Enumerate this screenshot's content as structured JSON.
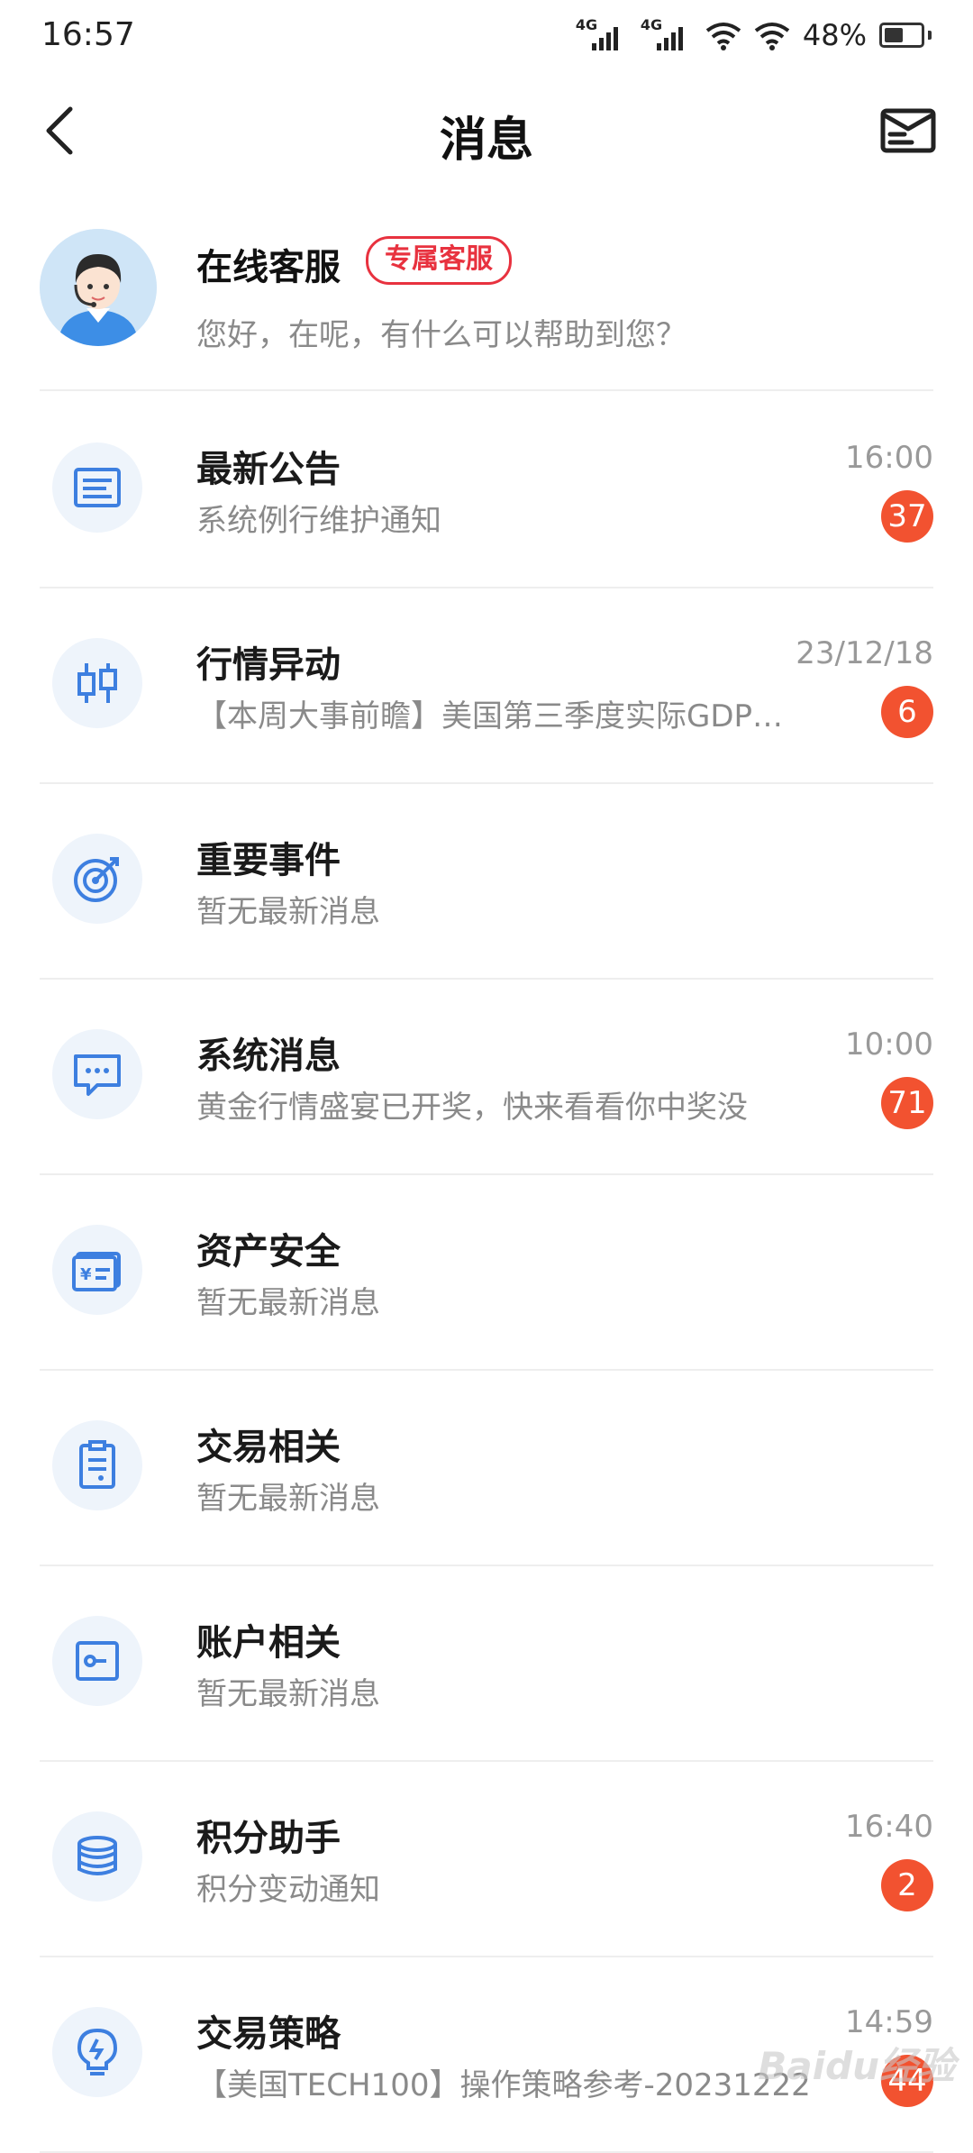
{
  "status_bar": {
    "time": "16:57",
    "network1": "4G",
    "network2": "4G",
    "battery": "48%"
  },
  "header": {
    "title": "消息"
  },
  "service": {
    "title": "在线客服",
    "tag": "专属客服",
    "subtitle": "您好，在呢，有什么可以帮助到您？"
  },
  "items": [
    {
      "title": "最新公告",
      "subtitle": "系统例行维护通知",
      "time": "16:00",
      "count": "37",
      "icon": "announcement-icon"
    },
    {
      "title": "行情异动",
      "subtitle": "【本周大事前瞻】美国第三季度实际GDP…",
      "time": "23/12/18",
      "count": "6",
      "icon": "candlestick-icon"
    },
    {
      "title": "重要事件",
      "subtitle": "暂无最新消息",
      "time": "",
      "count": "",
      "icon": "target-icon"
    },
    {
      "title": "系统消息",
      "subtitle": "黄金行情盛宴已开奖，快来看看你中奖没",
      "time": "10:00",
      "count": "71",
      "icon": "chat-bubble-icon"
    },
    {
      "title": "资产安全",
      "subtitle": "暂无最新消息",
      "time": "",
      "count": "",
      "icon": "asset-card-icon"
    },
    {
      "title": "交易相关",
      "subtitle": "暂无最新消息",
      "time": "",
      "count": "",
      "icon": "clipboard-icon"
    },
    {
      "title": "账户相关",
      "subtitle": "暂无最新消息",
      "time": "",
      "count": "",
      "icon": "account-key-icon"
    },
    {
      "title": "积分助手",
      "subtitle": "积分变动通知",
      "time": "16:40",
      "count": "2",
      "icon": "coins-icon"
    },
    {
      "title": "交易策略",
      "subtitle": "【美国TECH100】操作策略参考-20231222",
      "time": "14:59",
      "count": "44",
      "icon": "lightbulb-icon"
    }
  ],
  "watermark": "Baidu经验",
  "colors": {
    "accent_blue": "#3d7fe0",
    "badge_red": "#f25230",
    "tag_red": "#e8323f"
  }
}
